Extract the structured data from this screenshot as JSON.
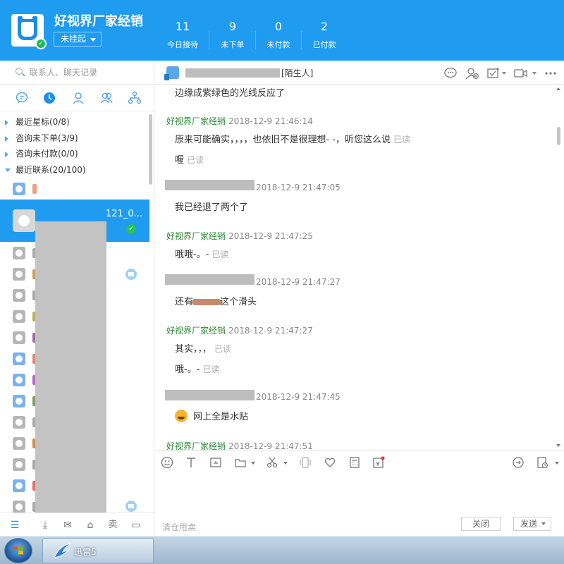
{
  "header": {
    "shop_name": "好视界厂家经销",
    "status": "未挂起",
    "stats": [
      {
        "value": "11",
        "label": "今日接待"
      },
      {
        "value": "9",
        "label": "未下单"
      },
      {
        "value": "0",
        "label": "未付款"
      },
      {
        "value": "2",
        "label": "已付款"
      }
    ],
    "colors": {
      "brand_blue": "#1f9bf0",
      "online_green": "#1dbb57"
    }
  },
  "left_panel": {
    "search_placeholder": "联系人、聊天记录",
    "tabs": [
      "chat-bubble-icon",
      "clock-icon",
      "person-icon",
      "group-icon",
      "org-chart-icon"
    ],
    "groups": [
      {
        "label": "最近星标(0/8)"
      },
      {
        "label": "咨询未下单(3/9)"
      },
      {
        "label": "咨询未付款(0/0)"
      },
      {
        "label": "最近联系(20/100)"
      }
    ],
    "selected_contact": {
      "partial_text": "121_0..."
    },
    "footer_icons": [
      "menu-icon",
      "download-icon",
      "mailbox-icon",
      "shop-icon",
      "sell-icon",
      "window-icon"
    ],
    "footer_sell_label": "卖"
  },
  "chat": {
    "contact_tag": "[陌生人]",
    "messages": {
      "m0": {
        "text": "边缘成紫绿色的光线反应了"
      },
      "m1": {
        "sender": "好视界厂家经销",
        "time": "2018-12-9 21:46:14",
        "text": "原来可能确实，，，，也依旧不是很理想- -，听您这么说",
        "read": "已读"
      },
      "m2": {
        "text": "喔",
        "read": "已读"
      },
      "m3": {
        "time": "2018-12-9 21:47:05",
        "text": "我已经退了两个了"
      },
      "m4": {
        "sender": "好视界厂家经销",
        "time": "2018-12-9 21:47:25",
        "text": "哦哦-。-",
        "read": "已读"
      },
      "m5": {
        "time": "2018-12-9 21:47:27",
        "text_before": "还有",
        "text_after": "这个滑头"
      },
      "m6": {
        "sender": "好视界厂家经销",
        "time": "2018-12-9 21:47:27",
        "text": "其实，，，",
        "read": "已读"
      },
      "m7": {
        "text": "哦-。-",
        "read": "已读"
      },
      "m8": {
        "time": "2018-12-9 21:47:45",
        "text": "网上全是水贴"
      },
      "m9": {
        "sender": "好视界厂家经销",
        "time": "2018-12-9 21:47:51"
      }
    },
    "toolbar_icons": [
      "emoji-icon",
      "font-icon",
      "screenshot-icon",
      "folder-icon",
      "scissors-icon",
      "shake-icon",
      "heart-icon",
      "calculator-icon",
      "coupon-icon",
      "quick-reply-icon",
      "history-icon"
    ],
    "input_hint": "清仓甩卖",
    "close_label": "关闭",
    "send_label": "发送"
  },
  "taskbar": {
    "app_label": "迅雷5"
  }
}
